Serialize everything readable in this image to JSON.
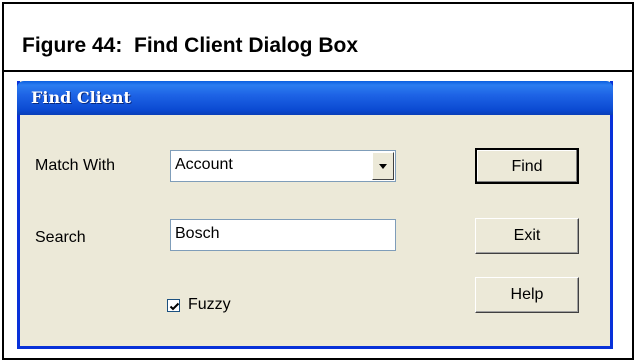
{
  "figure": {
    "caption": "Figure 44:  Find Client Dialog Box"
  },
  "dialog": {
    "title": "Find Client",
    "match_with": {
      "label": "Match With",
      "selected": "Account"
    },
    "search": {
      "label": "Search",
      "value": "Bosch"
    },
    "fuzzy": {
      "label": "Fuzzy",
      "checked": true
    },
    "buttons": {
      "find": "Find",
      "exit": "Exit",
      "help": "Help"
    }
  },
  "colors": {
    "titlebar": "#0b4ad2",
    "dialog_bg": "#ece9d8",
    "title_text": "#ffffff"
  }
}
